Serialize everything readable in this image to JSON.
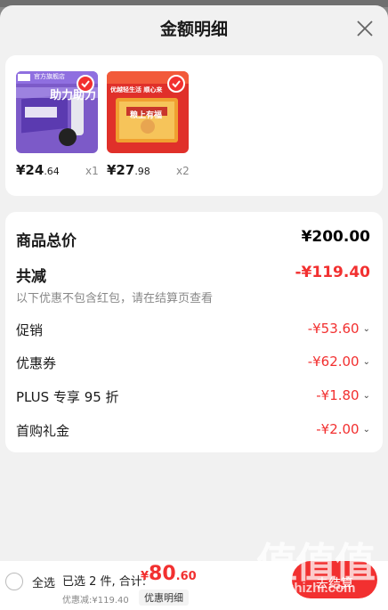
{
  "header": {
    "title": "金额明细",
    "close_icon": "close-icon"
  },
  "products": [
    {
      "price_int": "¥24",
      "price_dec": ".64",
      "qty": "x1",
      "thumb_color": "#7c5ac8",
      "banner_text": "官方旗舰店",
      "headline": "助力助力"
    },
    {
      "price_int": "¥27",
      "price_dec": ".98",
      "qty": "x2",
      "thumb_color": "#e0302a",
      "banner_text": "优越轻生活 顺心来",
      "headline": "粮上有福"
    }
  ],
  "summary": {
    "total_label": "商品总价",
    "total_value": "¥200.00",
    "reduce_label": "共减",
    "reduce_value": "-¥119.40",
    "note": "以下优惠不包含红包，请在结算页查看",
    "items": [
      {
        "label": "促销",
        "value": "-¥53.60"
      },
      {
        "label": "优惠券",
        "value": "-¥62.00"
      },
      {
        "label": "PLUS 专享 95 折",
        "value": "-¥1.80"
      },
      {
        "label": "首购礼金",
        "value": "-¥2.00"
      }
    ]
  },
  "bottom": {
    "select_all": "全选",
    "selected_text": "已选 2 件, 合计:",
    "total_yen": "¥",
    "total_int": "80",
    "total_dec": ".60",
    "discount_text": "优惠减:¥119.40",
    "detail_link": "优惠明细",
    "checkout": "去结算"
  },
  "watermark": {
    "big": "值值值",
    "small": "zhizhizhi.com"
  },
  "colors": {
    "accent": "#f23030",
    "sheet_bg": "#f1f1f1"
  }
}
